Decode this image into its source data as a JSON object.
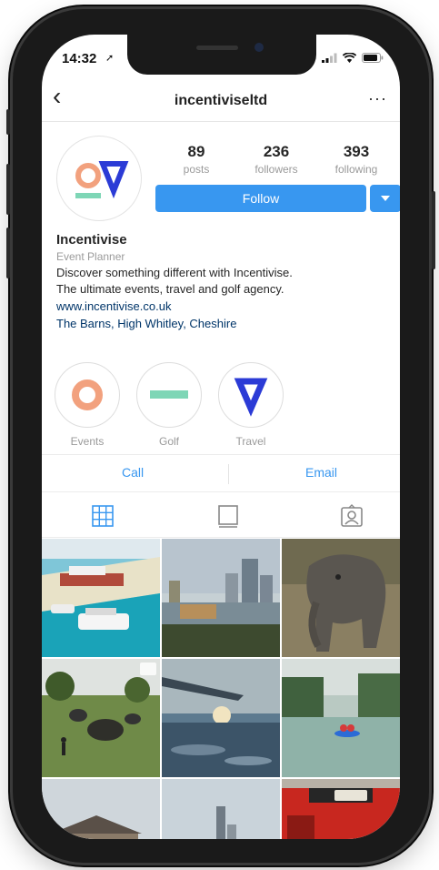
{
  "status_bar": {
    "time": "14:32"
  },
  "nav": {
    "back_glyph": "‹",
    "username": "incentiviseltd",
    "more_glyph": "···"
  },
  "profile": {
    "avatar_icon": "incentivise-logo-icon",
    "stats": [
      {
        "value": "89",
        "label": "posts"
      },
      {
        "value": "236",
        "label": "followers"
      },
      {
        "value": "393",
        "label": "following"
      }
    ],
    "follow_label": "Follow",
    "name": "Incentivise",
    "category": "Event Planner",
    "bio_lines": [
      "Discover something different with Incentivise.",
      "The ultimate events, travel and golf agency."
    ],
    "website": "www.incentivise.co.uk",
    "address": "The Barns, High Whitley, Cheshire"
  },
  "highlights": [
    {
      "label": "Events",
      "icon": "orange-ring-icon"
    },
    {
      "label": "Golf",
      "icon": "green-bar-icon"
    },
    {
      "label": "Travel",
      "icon": "blue-triangle-icon"
    }
  ],
  "contact": {
    "call_label": "Call",
    "email_label": "Email"
  },
  "tabs": [
    {
      "icon": "grid-icon",
      "active": true
    },
    {
      "icon": "feed-icon",
      "active": false
    },
    {
      "icon": "tagged-icon",
      "active": false
    }
  ],
  "colors": {
    "accent": "#3897f0",
    "brand_orange": "#f2a17e",
    "brand_green": "#7ed6b6",
    "brand_blue": "#2b3bd6",
    "link": "#003569"
  },
  "posts": [
    {
      "icon": "beach-resort-photo"
    },
    {
      "icon": "city-river-photo"
    },
    {
      "icon": "elephant-photo"
    },
    {
      "icon": "elephants-savanna-photo"
    },
    {
      "icon": "sky-sunset-photo"
    },
    {
      "icon": "kayak-river-photo"
    },
    {
      "icon": "building-photo"
    },
    {
      "icon": "skyline-photo"
    },
    {
      "icon": "red-vehicle-photo"
    }
  ]
}
